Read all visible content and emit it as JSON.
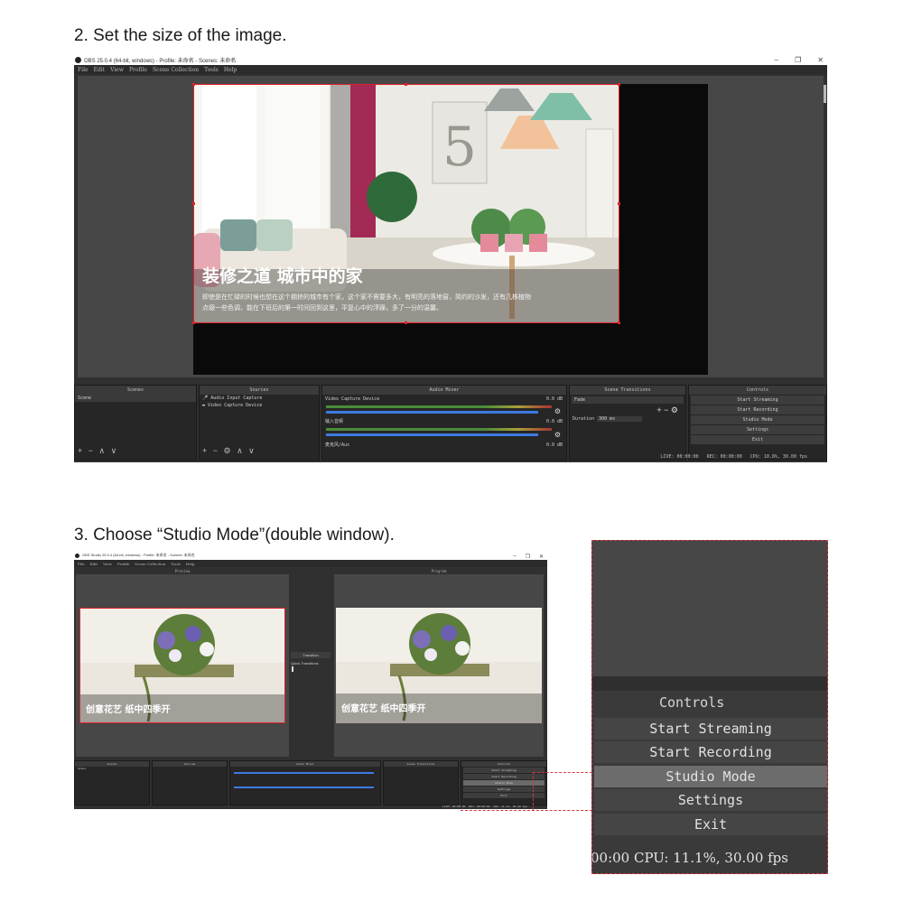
{
  "step2": {
    "title": "2. Set the size of the image."
  },
  "step3": {
    "title": "3. Choose “Studio Mode”(double window)."
  },
  "obs_window": {
    "title": "OBS 25.0.4 (64-bit, windows) - Profile: 未命名 - Scenes: 未命名",
    "menu": [
      "File",
      "Edit",
      "View",
      "Profile",
      "Scene Collection",
      "Tools",
      "Help"
    ],
    "window_controls": [
      "–",
      "❐",
      "✕"
    ],
    "preview_overlay": {
      "headline": "装修之道  城市中的家",
      "line1": "即使是在忙碌的时候也想在这个拥挤的城市有个家，这个家不需要多大，有明亮的落地窗，简约的沙发，还有几株植物",
      "line2": "点缀一些色调，能在下班后的第一时间回到这里，平复心中的浮躁，多了一分的温馨。"
    },
    "docks": {
      "scenes": {
        "title": "Scenes",
        "items": [
          "Scene"
        ]
      },
      "sources": {
        "title": "Sources",
        "items": [
          "Audio Input Capture",
          "Video Capture Device"
        ]
      },
      "mixer": {
        "title": "Audio Mixer",
        "channels": [
          {
            "name": "Video Capture Device",
            "db": "0.0 dB"
          },
          {
            "name": "输入音频",
            "db": "0.0 dB"
          },
          {
            "name": "麦克风/Aux",
            "db": "0.0 dB"
          }
        ]
      },
      "transitions": {
        "title": "Scene Transitions",
        "type": "Fade",
        "duration_label": "Duration",
        "duration_value": "300 ms"
      },
      "controls": {
        "title": "Controls",
        "buttons": [
          "Start Streaming",
          "Start Recording",
          "Studio Mode",
          "Settings",
          "Exit"
        ]
      }
    },
    "status": {
      "live": "LIVE: 00:00:00",
      "rec": "REC: 00:00:00",
      "cpu": "CPU: 10.8%, 30.00 fps"
    }
  },
  "obs_window_studio": {
    "title": "OBS Studio 25.0.4 (64-bit, windows) - Profile: 未命名 - Scenes: 未命名",
    "preview_label": "Preview",
    "program_label": "Program",
    "transition_button": "Transition",
    "quick_transitions": "Quick Transitions",
    "overlay_headline": "创意花艺  纸中四季开",
    "status": {
      "live": "LIVE: 00:00:00",
      "rec": "REC: 00:00:00",
      "cpu": "CPU: 11.1%, 30.00 fps"
    }
  },
  "zoom_panel": {
    "title": "Controls",
    "buttons": [
      "Start Streaming",
      "Start Recording",
      "Studio Mode",
      "Settings",
      "Exit"
    ],
    "active_button": "Studio Mode",
    "status_text": "00:00   CPU: 11.1%, 30.00 fps"
  }
}
